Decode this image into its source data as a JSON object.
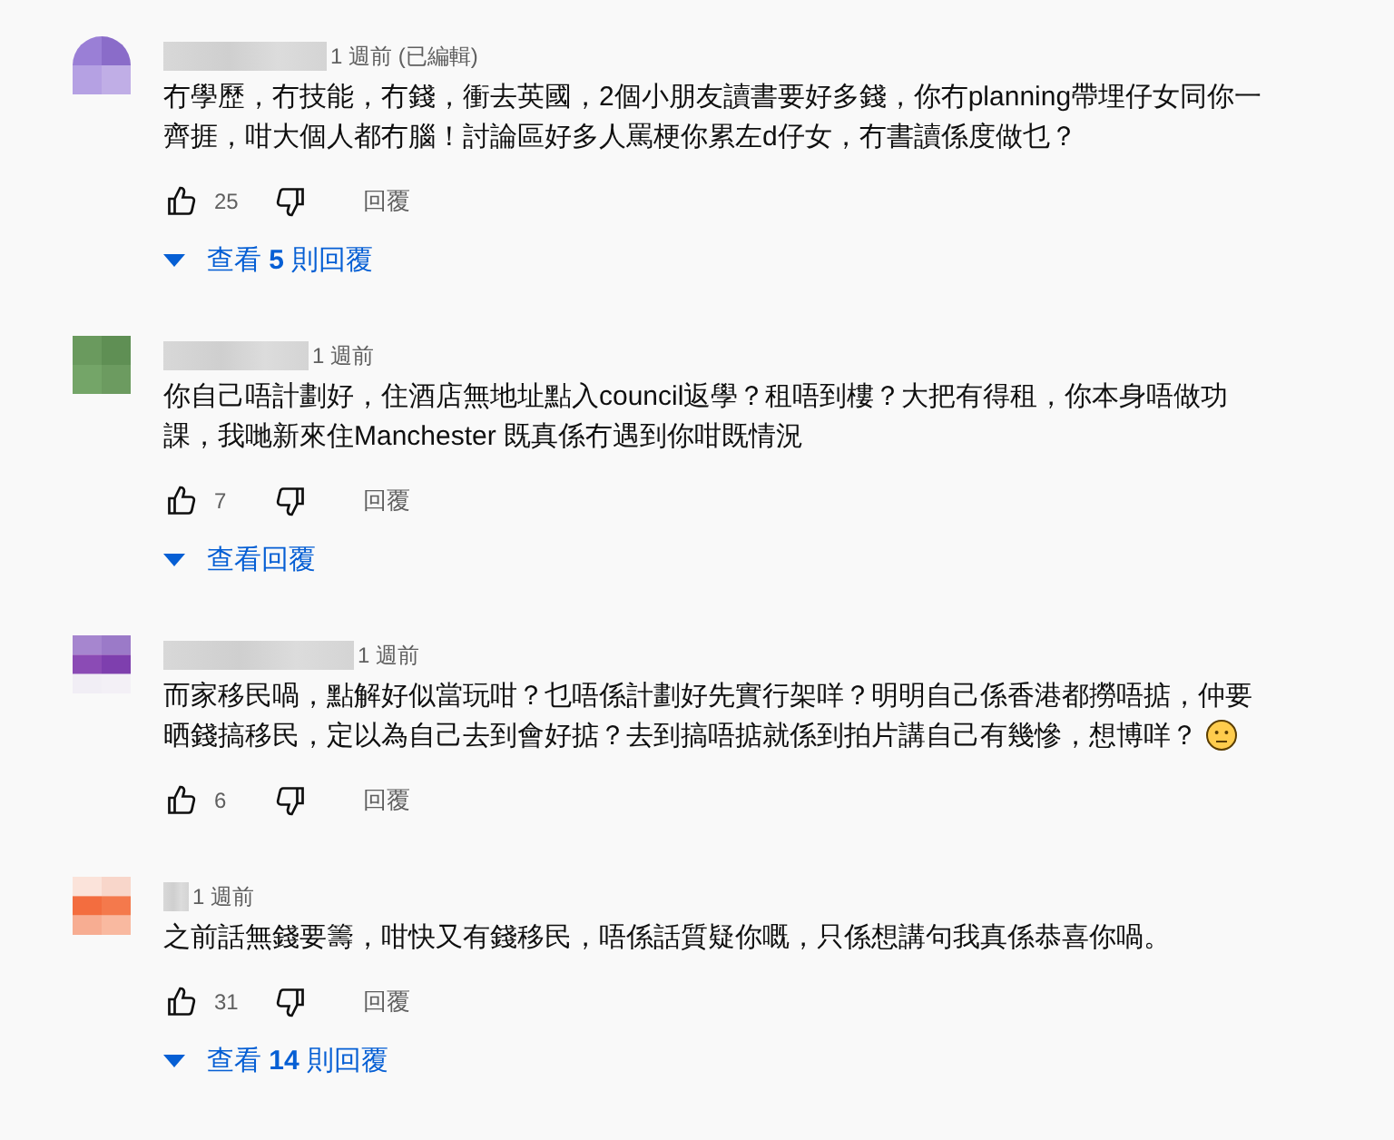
{
  "comments": [
    {
      "time": "1 週前 (已編輯)",
      "text": "冇學歷，冇技能，冇錢，衝去英國，2個小朋友讀書要好多錢，你冇planning帶埋仔女同你一齊捱，咁大個人都冇腦！討論區好多人罵梗你累左d仔女，冇書讀係度做乜？",
      "emoji": false,
      "likes": "25",
      "reply": "回覆",
      "replies": "查看 **5** 則回覆"
    },
    {
      "time": "1 週前",
      "text": "你自己唔計劃好，住酒店無地址點入council返學？租唔到樓？大把有得租，你本身唔做功課，我哋新來住Manchester 既真係冇遇到你咁既情況",
      "emoji": false,
      "likes": "7",
      "reply": "回覆",
      "replies": "查看回覆"
    },
    {
      "time": "1 週前",
      "text": "而家移民喎，點解好似當玩咁？乜唔係計劃好先實行架咩？明明自己係香港都撈唔掂，仲要晒錢搞移民，定以為自己去到會好掂？去到搞唔掂就係到拍片講自己有幾慘，想博咩？",
      "emoji": true,
      "likes": "6",
      "reply": "回覆"
    },
    {
      "time": "1 週前",
      "text": "之前話無錢要籌，咁快又有錢移民，唔係話質疑你嘅，只係想講句我真係恭喜你喎。",
      "emoji": false,
      "likes": "31",
      "reply": "回覆",
      "replies": "查看 **14** 則回覆"
    }
  ]
}
